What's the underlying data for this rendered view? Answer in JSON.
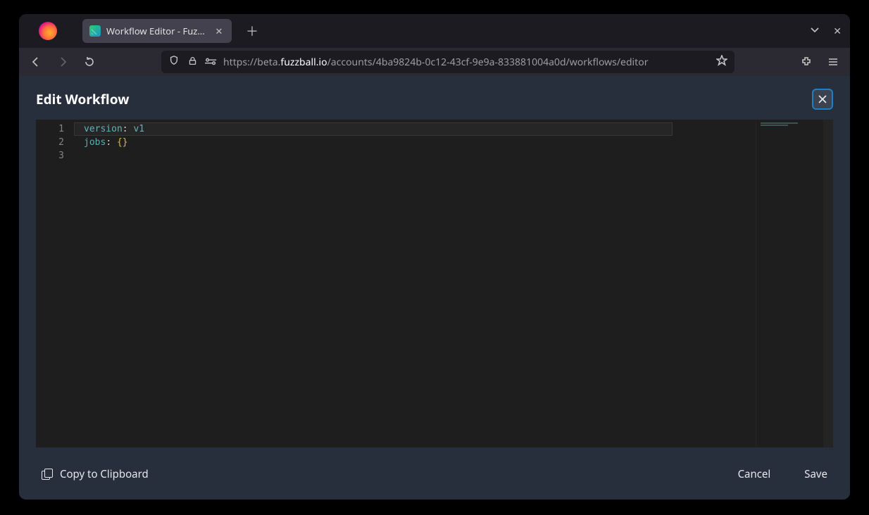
{
  "browser": {
    "tab_title": "Workflow Editor - Fuzzba",
    "url_prefix": "https://beta.",
    "url_host": "fuzzball.io",
    "url_path": "/accounts/4ba9824b-0c12-43cf-9e9a-833881004a0d/workflows/editor"
  },
  "modal": {
    "title": "Edit Workflow",
    "copy_label": "Copy to Clipboard",
    "cancel_label": "Cancel",
    "save_label": "Save"
  },
  "editor": {
    "lines": [
      {
        "n": "1",
        "key": "version",
        "colon": ": ",
        "value": "v1",
        "brace": ""
      },
      {
        "n": "2",
        "key": "jobs",
        "colon": ": ",
        "value": "",
        "brace": "{}"
      },
      {
        "n": "3",
        "key": "",
        "colon": "",
        "value": "",
        "brace": ""
      }
    ]
  }
}
